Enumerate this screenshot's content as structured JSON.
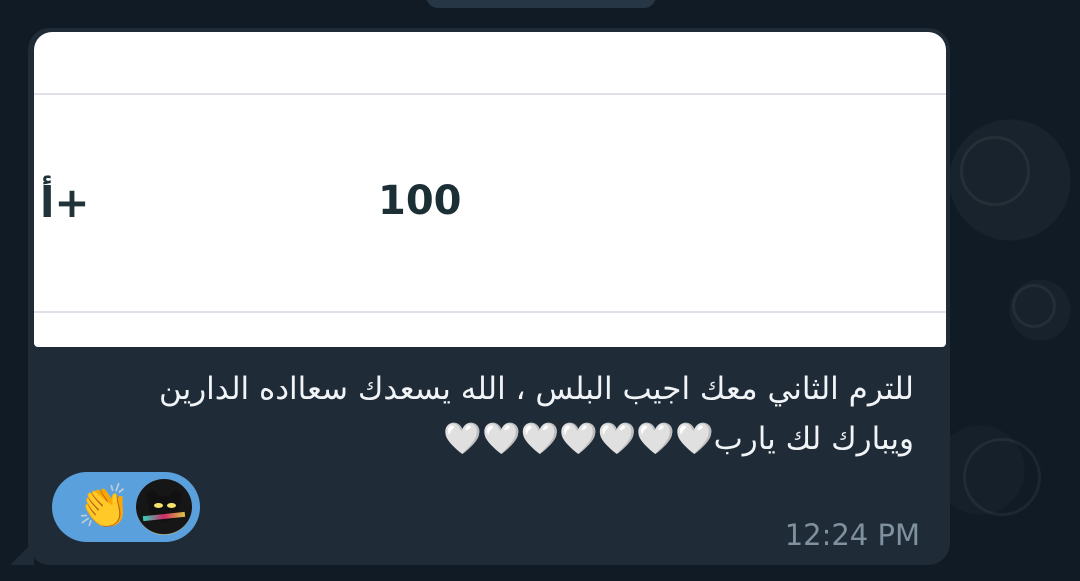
{
  "message": {
    "image_content": {
      "grade": "أ+",
      "score": "100"
    },
    "text": "للترم الثاني معك اجيب البلس ، الله يسعدك سعااده الدارين\nويبارك لك يارب🤍🤍🤍🤍🤍🤍🤍",
    "reactions": {
      "clap_icon": "👏",
      "avatar_icon": "black-cat-avatar"
    },
    "time": "12:24 PM"
  },
  "theme": {
    "background": "#101b25",
    "bubble": "#1f2b37",
    "reaction": "#5aa0dc",
    "text": "#f1f4f7",
    "timestamp": "#7f909e"
  }
}
